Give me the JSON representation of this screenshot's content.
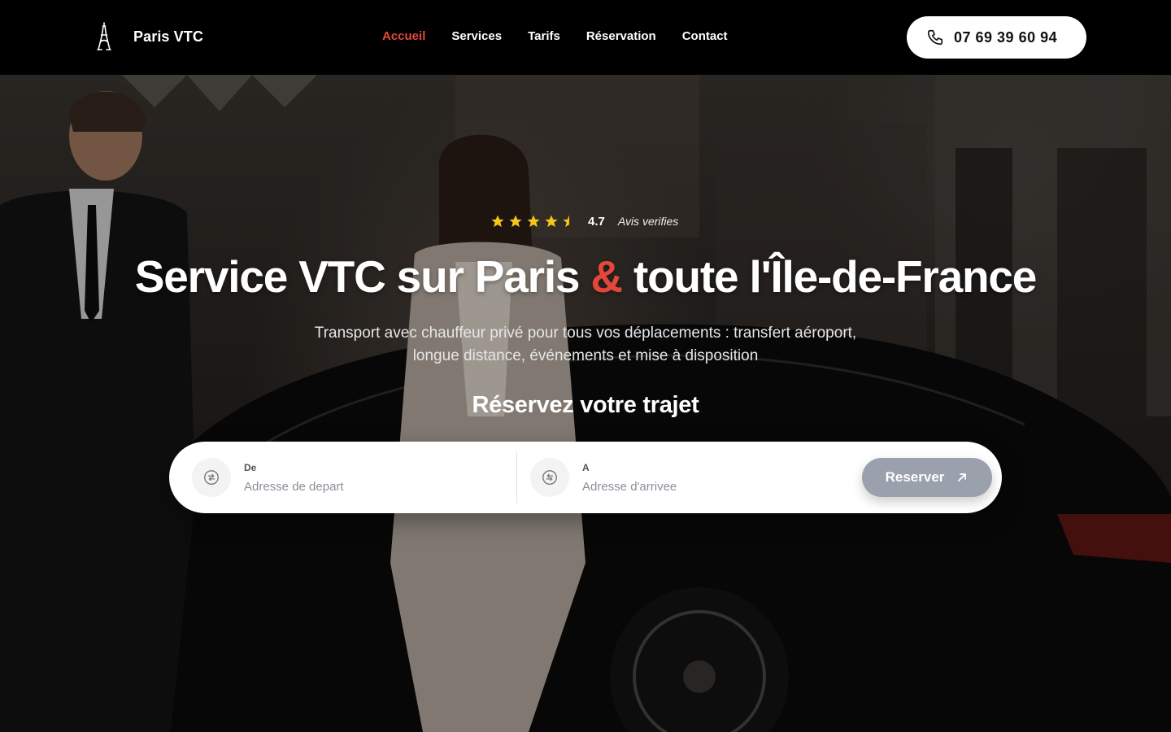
{
  "header": {
    "brand": "Paris VTC",
    "nav": [
      "Accueil",
      "Services",
      "Tarifs",
      "Réservation",
      "Contact"
    ],
    "active_nav": "Accueil",
    "phone": "07 69 39 60 94"
  },
  "hero": {
    "rating": {
      "value": "4.7",
      "stars": 4.5,
      "label": "Avis verifies"
    },
    "title_part1": "Service VTC sur Paris ",
    "title_amp": "&",
    "title_part2": " toute l'Île-de-France",
    "subtitle": "Transport avec chauffeur privé pour tous vos déplacements : transfert aéroport, longue distance, événements et mise à disposition",
    "booking_title": "Réservez votre trajet"
  },
  "booking": {
    "from_label": "De",
    "from_placeholder": "Adresse de depart",
    "to_label": "A",
    "to_placeholder": "Adresse d'arrivee",
    "reserve_label": "Reserver"
  },
  "colors": {
    "accent": "#e4473a",
    "star": "#f5c518",
    "button_disabled": "#9aa0ac"
  }
}
